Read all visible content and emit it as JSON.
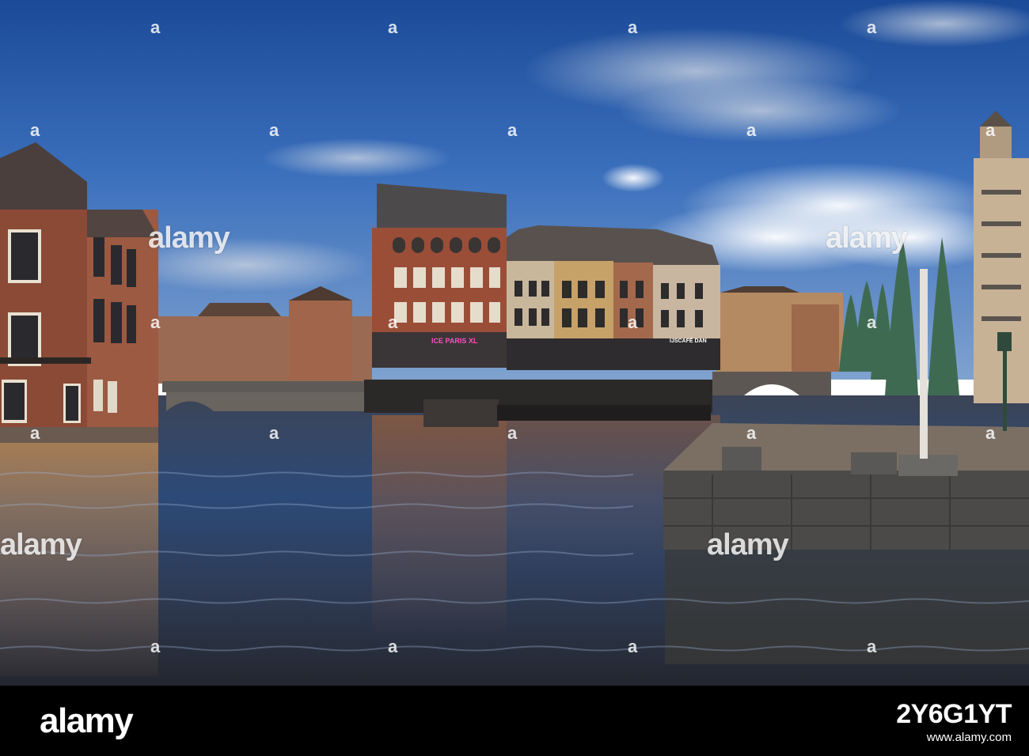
{
  "watermark": {
    "brand": "alamy",
    "letter": "a"
  },
  "signs": {
    "pink_sign": "ICE PARIS XL",
    "cafe_sign": "IJSCAFÉ DAN"
  },
  "footer": {
    "brand": "alamy",
    "image_id": "2Y6G1YT",
    "url": "www.alamy.com"
  },
  "colors": {
    "sky_top": "#1d4f9e",
    "sky_mid": "#3f76c2",
    "water": "#2f3a4a",
    "brick": "#8a4a36",
    "footer_bg": "#000000"
  }
}
